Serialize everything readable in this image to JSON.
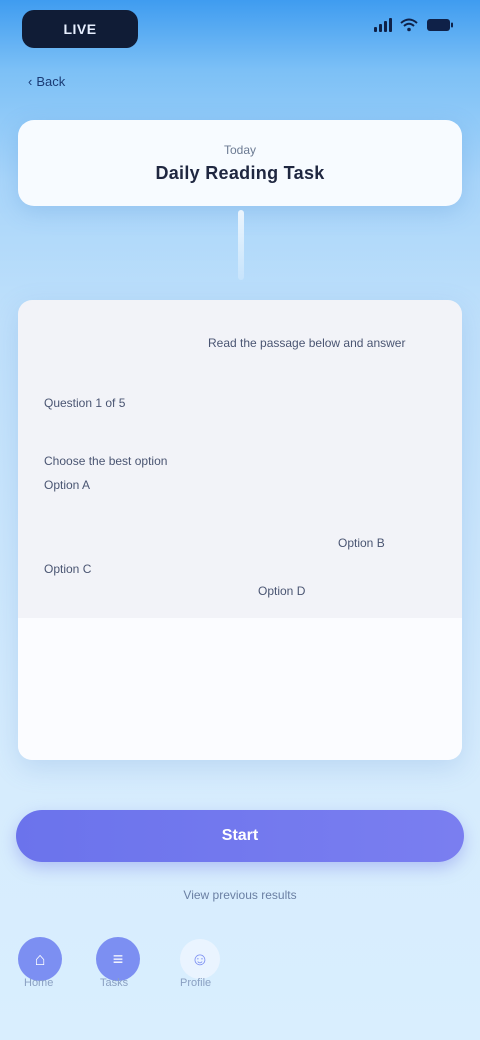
{
  "status": {
    "app_label": "LIVE",
    "colors": {
      "pill": "#101c36"
    }
  },
  "nav": {
    "back_label": "Back"
  },
  "title_card": {
    "caption": "Today",
    "title": "Daily Reading Task"
  },
  "content": {
    "lines": [
      {
        "text": "Read the passage below and answer",
        "cls": "l1"
      },
      {
        "text": "Question 1 of 5",
        "cls": "l2"
      },
      {
        "text": "Choose the best option",
        "cls": "l3"
      },
      {
        "text": "Option A",
        "cls": "l4"
      },
      {
        "text": "Option B",
        "cls": "l5"
      },
      {
        "text": "Option C",
        "cls": "l6"
      },
      {
        "text": "Option D",
        "cls": "l7"
      }
    ]
  },
  "actions": {
    "primary_label": "Start",
    "sub_link": "View previous results"
  },
  "bottom_bar": {
    "labels": [
      "Home",
      "Tasks",
      "Profile"
    ]
  },
  "colors": {
    "accent": "#6b73ec",
    "background_top": "#3f9cf0",
    "background_bottom": "#d9eefe"
  }
}
